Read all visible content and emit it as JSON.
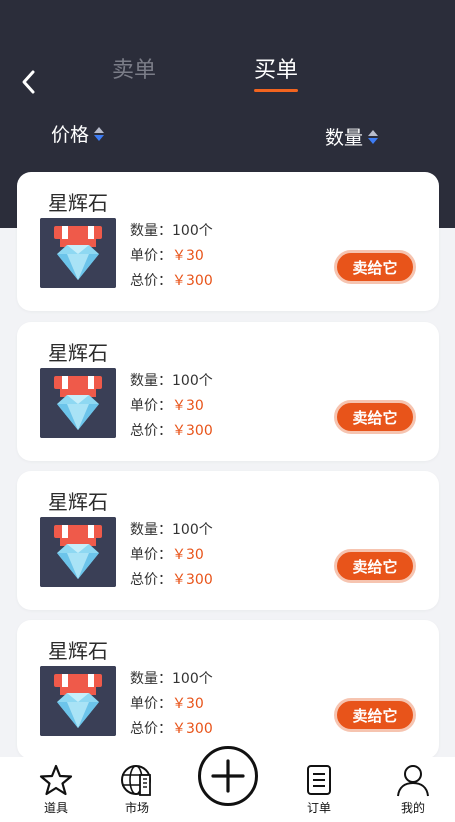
{
  "header": {
    "tabs": [
      {
        "label": "卖单",
        "active": false
      },
      {
        "label": "买单",
        "active": true
      }
    ],
    "sort": {
      "price_label": "价格",
      "quantity_label": "数量"
    }
  },
  "colors": {
    "header_bg": "#2b2d3a",
    "accent": "#e8541a",
    "active_tab_underline": "#f2641f"
  },
  "orders": [
    {
      "name": "星辉石",
      "quantity": "数量：100个",
      "unit_price_label": "单价：",
      "unit_price": "￥30",
      "total_label": "总价：",
      "total": "￥300",
      "action": "卖给它",
      "icon": "diamond-medal-icon"
    },
    {
      "name": "星辉石",
      "quantity": "数量：100个",
      "unit_price_label": "单价：",
      "unit_price": "￥30",
      "total_label": "总价：",
      "total": "￥300",
      "action": "卖给它",
      "icon": "diamond-medal-icon"
    },
    {
      "name": "星辉石",
      "quantity": "数量：100个",
      "unit_price_label": "单价：",
      "unit_price": "￥30",
      "total_label": "总价：",
      "total": "￥300",
      "action": "卖给它",
      "icon": "diamond-medal-icon"
    },
    {
      "name": "星辉石",
      "quantity": "数量：100个",
      "unit_price_label": "单价：",
      "unit_price": "￥30",
      "total_label": "总价：",
      "total": "￥300",
      "action": "卖给它",
      "icon": "diamond-medal-icon"
    }
  ],
  "bottom_nav": {
    "items": [
      {
        "label": "道具",
        "icon": "star-icon"
      },
      {
        "label": "市场",
        "icon": "globe-building-icon"
      },
      {
        "label": "订单",
        "icon": "document-icon"
      },
      {
        "label": "我的",
        "icon": "person-icon"
      }
    ],
    "center_icon": "plus-icon"
  }
}
